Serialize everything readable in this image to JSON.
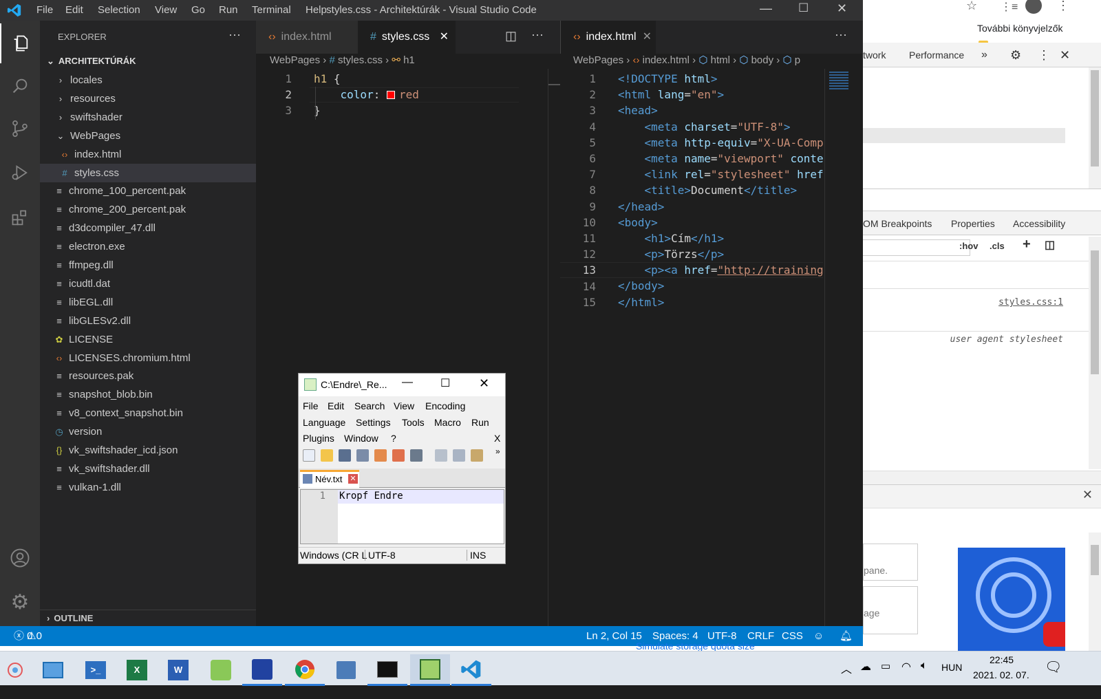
{
  "vscode": {
    "title": "styles.css - Architektúrák - Visual Studio Code",
    "menu": [
      "File",
      "Edit",
      "Selection",
      "View",
      "Go",
      "Run",
      "Terminal",
      "Help"
    ],
    "explorer": {
      "header": "EXPLORER",
      "project": "ARCHITEKTÚRÁK",
      "items": [
        {
          "label": "locales",
          "icon": "chevron-right-icon"
        },
        {
          "label": "resources",
          "icon": "chevron-right-icon"
        },
        {
          "label": "swiftshader",
          "icon": "chevron-right-icon"
        },
        {
          "label": "WebPages",
          "icon": "chevron-down-icon"
        },
        {
          "label": "index.html",
          "icon": "html-file-icon"
        },
        {
          "label": "styles.css",
          "icon": "css-file-icon"
        },
        {
          "label": "chrome_100_percent.pak",
          "icon": "file-lines-icon"
        },
        {
          "label": "chrome_200_percent.pak",
          "icon": "file-lines-icon"
        },
        {
          "label": "d3dcompiler_47.dll",
          "icon": "file-lines-icon"
        },
        {
          "label": "electron.exe",
          "icon": "file-lines-icon"
        },
        {
          "label": "ffmpeg.dll",
          "icon": "file-lines-icon"
        },
        {
          "label": "icudtl.dat",
          "icon": "file-lines-icon"
        },
        {
          "label": "libEGL.dll",
          "icon": "file-lines-icon"
        },
        {
          "label": "libGLESv2.dll",
          "icon": "file-lines-icon"
        },
        {
          "label": "LICENSE",
          "icon": "license-icon"
        },
        {
          "label": "LICENSES.chromium.html",
          "icon": "html-file-icon"
        },
        {
          "label": "resources.pak",
          "icon": "file-lines-icon"
        },
        {
          "label": "snapshot_blob.bin",
          "icon": "file-lines-icon"
        },
        {
          "label": "v8_context_snapshot.bin",
          "icon": "file-lines-icon"
        },
        {
          "label": "version",
          "icon": "clock-icon"
        },
        {
          "label": "vk_swiftshader_icd.json",
          "icon": "json-icon"
        },
        {
          "label": "vk_swiftshader.dll",
          "icon": "file-lines-icon"
        },
        {
          "label": "vulkan-1.dll",
          "icon": "file-lines-icon"
        }
      ],
      "outline": "OUTLINE"
    },
    "left_group": {
      "tabs": [
        {
          "label": "index.html",
          "active": false
        },
        {
          "label": "styles.css",
          "active": true
        }
      ],
      "breadcrumb": [
        "WebPages",
        "styles.css",
        "h1"
      ],
      "line_numbers": [
        "1",
        "2",
        "3"
      ],
      "code": [
        [
          {
            "t": "h1 ",
            "c": "sel-t"
          },
          {
            "t": "{",
            "c": "tx"
          }
        ],
        [
          {
            "t": "    ",
            "c": "tx"
          },
          {
            "t": "color",
            "c": "at"
          },
          {
            "t": ": ",
            "c": "tx"
          },
          {
            "t": "■",
            "c": "swatch"
          },
          {
            "t": "red",
            "c": "st"
          }
        ],
        [
          {
            "t": "}",
            "c": "tx"
          }
        ]
      ]
    },
    "right_group": {
      "tabs": [
        {
          "label": "index.html",
          "active": true
        }
      ],
      "breadcrumb": [
        "WebPages",
        "index.html",
        "html",
        "body",
        "p"
      ],
      "line_numbers": [
        "1",
        "2",
        "3",
        "4",
        "5",
        "6",
        "7",
        "8",
        "9",
        "10",
        "11",
        "12",
        "13",
        "14",
        "15"
      ],
      "code": [
        [
          {
            "t": "<!DOCTYPE ",
            "c": "kw"
          },
          {
            "t": "html",
            "c": "at"
          },
          {
            "t": ">",
            "c": "kw"
          }
        ],
        [
          {
            "t": "<html ",
            "c": "kw"
          },
          {
            "t": "lang",
            "c": "at"
          },
          {
            "t": "=",
            "c": "tx"
          },
          {
            "t": "\"en\"",
            "c": "st"
          },
          {
            "t": ">",
            "c": "kw"
          }
        ],
        [
          {
            "t": "<head>",
            "c": "kw"
          }
        ],
        [
          {
            "t": "    <meta ",
            "c": "kw"
          },
          {
            "t": "charset",
            "c": "at"
          },
          {
            "t": "=",
            "c": "tx"
          },
          {
            "t": "\"UTF-8\"",
            "c": "st"
          },
          {
            "t": ">",
            "c": "kw"
          }
        ],
        [
          {
            "t": "    <meta ",
            "c": "kw"
          },
          {
            "t": "http-equiv",
            "c": "at"
          },
          {
            "t": "=",
            "c": "tx"
          },
          {
            "t": "\"X-UA-Compa",
            "c": "st"
          }
        ],
        [
          {
            "t": "    <meta ",
            "c": "kw"
          },
          {
            "t": "name",
            "c": "at"
          },
          {
            "t": "=",
            "c": "tx"
          },
          {
            "t": "\"viewport\"",
            "c": "st"
          },
          {
            "t": " conten",
            "c": "at"
          }
        ],
        [
          {
            "t": "    <link ",
            "c": "kw"
          },
          {
            "t": "rel",
            "c": "at"
          },
          {
            "t": "=",
            "c": "tx"
          },
          {
            "t": "\"stylesheet\"",
            "c": "st"
          },
          {
            "t": " href=",
            "c": "at"
          }
        ],
        [
          {
            "t": "    <title>",
            "c": "kw"
          },
          {
            "t": "Document",
            "c": "tx"
          },
          {
            "t": "</title>",
            "c": "kw"
          }
        ],
        [
          {
            "t": "</head>",
            "c": "kw"
          }
        ],
        [
          {
            "t": "<body>",
            "c": "kw"
          }
        ],
        [
          {
            "t": "    <h1>",
            "c": "kw"
          },
          {
            "t": "Cím",
            "c": "tx"
          },
          {
            "t": "</h1>",
            "c": "kw"
          }
        ],
        [
          {
            "t": "    <p>",
            "c": "kw"
          },
          {
            "t": "Törzs",
            "c": "tx"
          },
          {
            "t": "</p>",
            "c": "kw"
          }
        ],
        [
          {
            "t": "    <p><a ",
            "c": "kw"
          },
          {
            "t": "href",
            "c": "at"
          },
          {
            "t": "=",
            "c": "tx"
          },
          {
            "t": "\"http://training3",
            "c": "st"
          }
        ],
        [
          {
            "t": "</body>",
            "c": "kw"
          }
        ],
        [
          {
            "t": "</html>",
            "c": "kw"
          }
        ]
      ]
    },
    "status": {
      "errors": "0",
      "warnings": "0",
      "position": "Ln 2, Col 15",
      "spaces": "Spaces: 4",
      "encoding": "UTF-8",
      "eol": "CRLF",
      "language": "CSS"
    }
  },
  "chrome": {
    "bookmark": "További könyvjelzők",
    "devtools_tabs": [
      "twork",
      "Performance",
      "»"
    ],
    "sidebar_tabs": [
      "OM Breakpoints",
      "Properties",
      "Accessibility"
    ],
    "filter_buttons": [
      ":hov",
      ".cls",
      "+"
    ],
    "style_source": "styles.css:1",
    "user_agent": "user agent stylesheet",
    "card1": "pane.",
    "card2": "age",
    "bottom_text": "Simulate storage quota size"
  },
  "notepad": {
    "title": "C:\\Endre\\_Re...",
    "menu_rows": [
      [
        "File",
        "Edit",
        "Search",
        "View",
        "Encoding"
      ],
      [
        "Language",
        "Settings",
        "Tools",
        "Macro",
        "Run"
      ],
      [
        "Plugins",
        "Window",
        "?"
      ]
    ],
    "menu_close": "X",
    "tab": "Név.txt",
    "line_number": "1",
    "text": "Kropf Endre",
    "status": {
      "eol": "Windows (CR L",
      "encoding": "UTF-8",
      "mode": "INS"
    }
  },
  "taskbar": {
    "language": "HUN",
    "time": "22:45",
    "date": "2021. 02. 07."
  },
  "colors": {
    "vscode_blue": "#007acc",
    "activity": "#333333",
    "sidebar": "#252526",
    "editor": "#1e1e1e"
  }
}
